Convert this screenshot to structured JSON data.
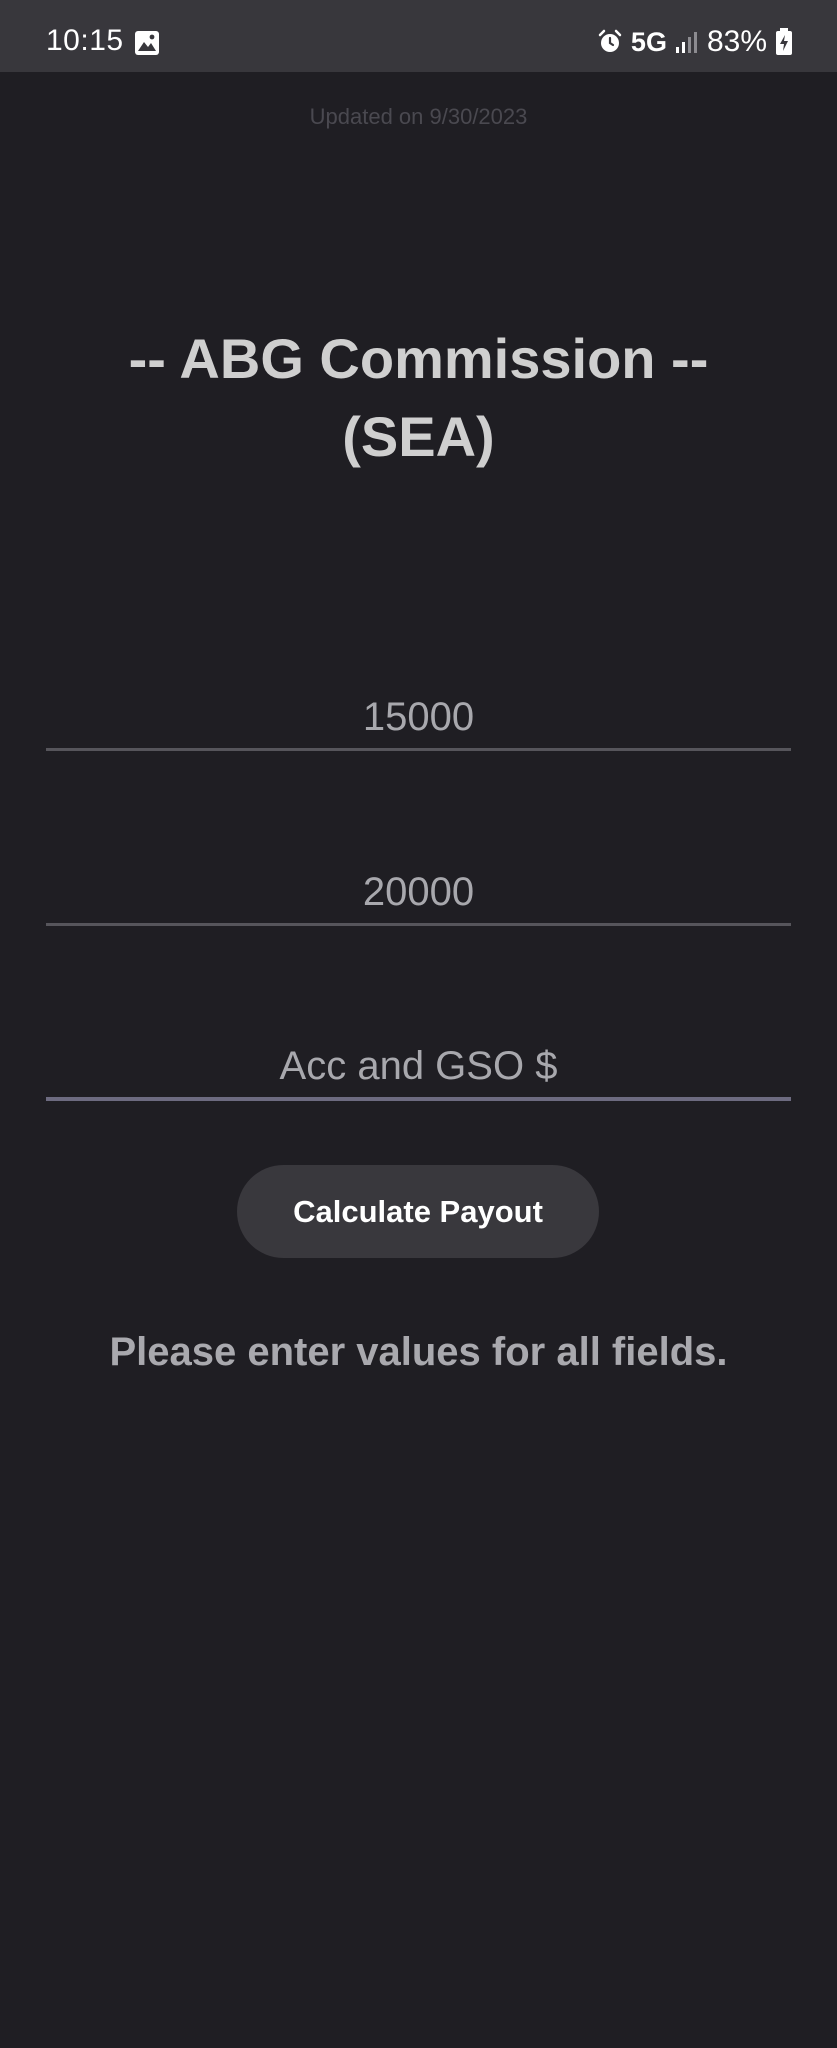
{
  "status_bar": {
    "time": "10:15",
    "network": "5G",
    "battery": "83%"
  },
  "updated_text": "Updated on 9/30/2023",
  "title": {
    "line1": "-- ABG Commission --",
    "line2": "(SEA)"
  },
  "fields": [
    {
      "value": "15000"
    },
    {
      "value": "20000"
    },
    {
      "placeholder": "Acc and GSO $"
    }
  ],
  "calculate_button": "Calculate Payout",
  "message": "Please enter values for all fields.",
  "colors": {
    "background": "#1f1e23",
    "status_bar": "#38373c",
    "button": "#39383d"
  }
}
